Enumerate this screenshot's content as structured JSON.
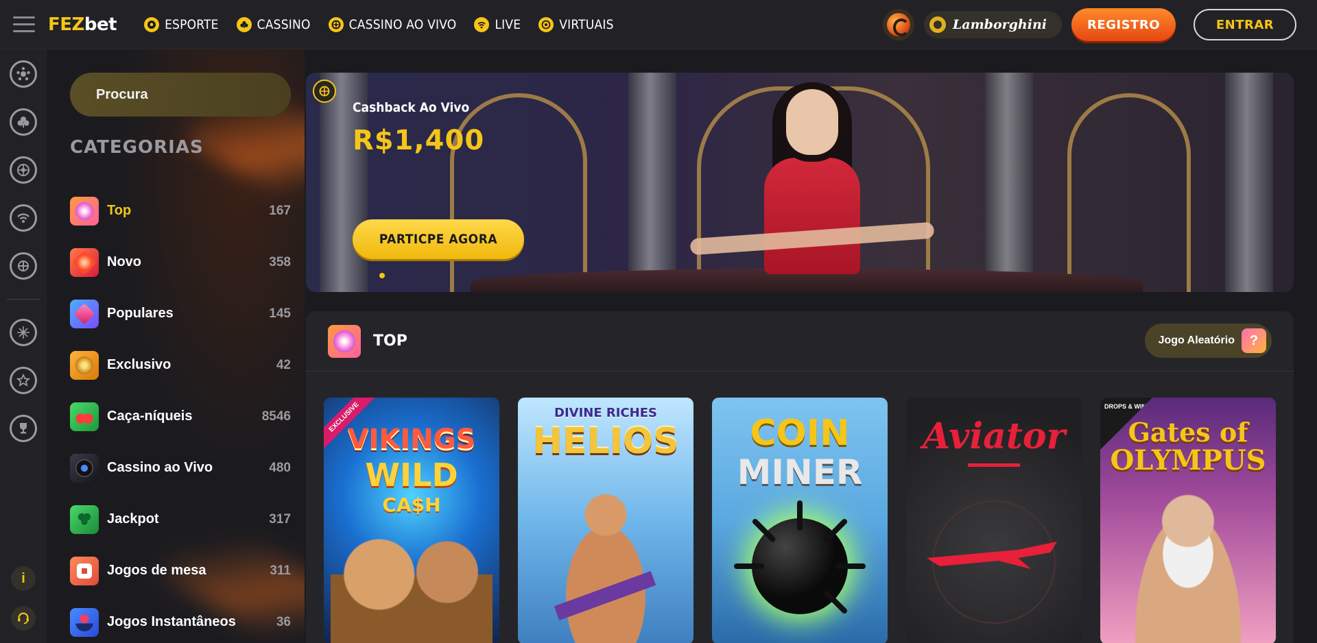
{
  "brand": {
    "logo_fez": "FEZ",
    "logo_bet": "bet"
  },
  "nav": [
    {
      "label": "ESPORTE",
      "icon": "soccer-ball-icon"
    },
    {
      "label": "CASSINO",
      "icon": "club-suit-icon"
    },
    {
      "label": "CASSINO AO VIVO",
      "icon": "roulette-icon"
    },
    {
      "label": "LIVE",
      "icon": "live-signal-icon"
    },
    {
      "label": "VIRTUAIS",
      "icon": "virtual-ball-icon"
    }
  ],
  "header": {
    "promo_label": "Lamborghini",
    "register_label": "REGISTRO",
    "login_label": "ENTRAR"
  },
  "rail": {
    "icons": [
      "soccer-ball-icon",
      "club-suit-icon",
      "roulette-icon",
      "live-signal-icon",
      "virtual-ball-icon",
      "wheel-icon",
      "star-badge-icon",
      "trophy-icon"
    ],
    "info_label": "i"
  },
  "search": {
    "placeholder": "Procura"
  },
  "categories": {
    "title": "CATEGORIAS",
    "items": [
      {
        "label": "Top",
        "count": "167",
        "active": true,
        "color": "#ff7ad0"
      },
      {
        "label": "Novo",
        "count": "358",
        "active": false,
        "color": "#ff4a3a"
      },
      {
        "label": "Populares",
        "count": "145",
        "active": false,
        "color": "#ff3a8a"
      },
      {
        "label": "Exclusivo",
        "count": "42",
        "active": false,
        "color": "#f5a518"
      },
      {
        "label": "Caça-níqueis",
        "count": "8546",
        "active": false,
        "color": "#3ac85a"
      },
      {
        "label": "Cassino ao Vivo",
        "count": "480",
        "active": false,
        "color": "#2a2a3a"
      },
      {
        "label": "Jackpot",
        "count": "317",
        "active": false,
        "color": "#2ab84a"
      },
      {
        "label": "Jogos de mesa",
        "count": "311",
        "active": false,
        "color": "#ff6a4a"
      },
      {
        "label": "Jogos Instantâneos",
        "count": "36",
        "active": false,
        "color": "#3a7aff"
      }
    ]
  },
  "banner": {
    "subtitle": "Cashback Ao Vivo",
    "amount": "R$1,400",
    "cta": "PARTICPE AGORA"
  },
  "top_section": {
    "title": "TOP",
    "random_label": "Jogo Aleatório",
    "games": [
      {
        "title_1": "VIKINGS",
        "title_2": "WILD",
        "title_3": "CA$H",
        "tag": "EXCLUSIVE"
      },
      {
        "title_1": "DIVINE RICHES",
        "title_2": "HELIOS"
      },
      {
        "title_1": "COIN",
        "title_2": "MINER"
      },
      {
        "title_1": "Aviator"
      },
      {
        "title_1": "Gates of",
        "title_2": "OLYMPUS",
        "tag": "DROPS & WINS"
      }
    ]
  },
  "colors": {
    "accent": "#f5c518",
    "register": "#e54810",
    "background": "#1b1b1f"
  }
}
